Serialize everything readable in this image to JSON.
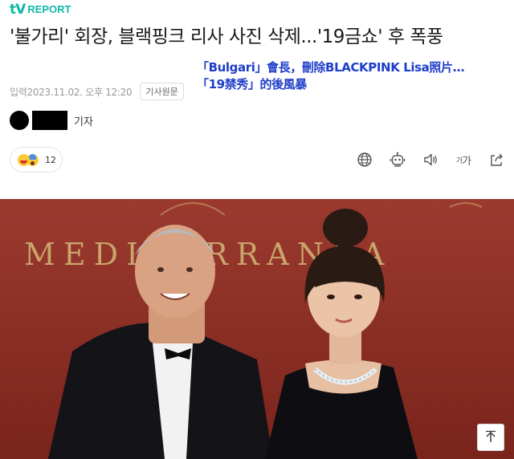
{
  "brand": {
    "tv": "tV",
    "report": "REPORT",
    "color": "#10b9a4"
  },
  "article": {
    "headline": "'불가리' 회장, 블랙핑크 리사 사진 삭제...'19금쇼' 후 폭풍",
    "caption_line1": "「Bulgari」會長，刪除BLACKPINK Lisa照片…",
    "caption_line2": "「19禁秀」的後風暴",
    "caption_color": "#1f3ec9",
    "date": "입력2023.11.02. 오후 12:20",
    "source_button": "기사원문",
    "reporter_role": "기자",
    "reaction_count": "12",
    "photo_sign_text": "MEDITERRANEA"
  },
  "icons": {
    "reaction_1": "happy-face-emoji",
    "reaction_2": "surprised-face-emoji",
    "tools": [
      "globe-icon",
      "robot-icon",
      "speaker-icon",
      "font-size-icon",
      "share-icon"
    ],
    "font_tool_small": "가",
    "font_tool_big": "가",
    "scroll_top": "arrow-up-icon"
  }
}
